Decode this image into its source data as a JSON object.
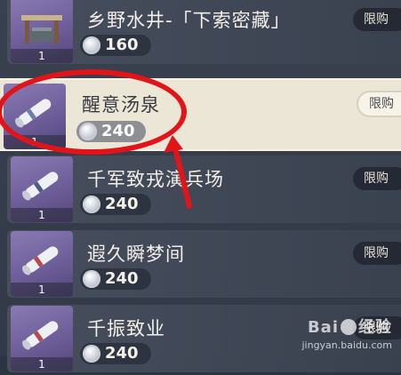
{
  "shop": {
    "items": [
      {
        "name": "乡野水井-「下索密藏」",
        "price": "160",
        "count": "1",
        "limit_label": "限购",
        "icon": "well-furniture-icon"
      },
      {
        "name": "醒意汤泉",
        "price": "240",
        "count": "1",
        "limit_label": "限购",
        "icon": "blueprint-scroll-icon",
        "selected": true
      },
      {
        "name": "千军致戎演兵场",
        "price": "240",
        "count": "1",
        "limit_label": "限购",
        "icon": "blueprint-scroll-icon"
      },
      {
        "name": "遐久瞬梦间",
        "price": "240",
        "count": "1",
        "limit_label": "限购",
        "icon": "blueprint-scroll-icon"
      },
      {
        "name": "千振致业",
        "price": "240",
        "count": "1",
        "limit_label": "限购",
        "icon": "blueprint-scroll-icon"
      }
    ]
  },
  "annotation": {
    "color": "#e2141a"
  },
  "watermark": {
    "logo_a": "Bai",
    "logo_b": "经验",
    "url": "jingyan.baidu.com"
  },
  "colors": {
    "selected_row": "#ece6d6",
    "row": "#3c4352",
    "thumb": "#7a6aa6"
  }
}
